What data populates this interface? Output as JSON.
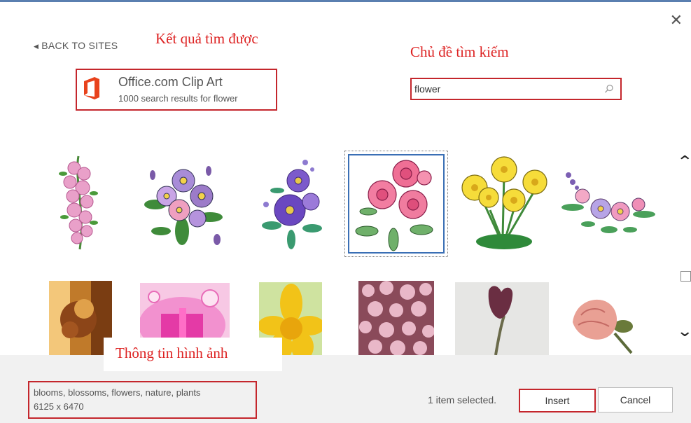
{
  "dialog": {
    "close_glyph": "✕"
  },
  "nav": {
    "back_label": "BACK TO SITES",
    "back_icon": "triangle-left-icon"
  },
  "annotations": {
    "results_found": "Kết quả tìm được",
    "search_topic": "Chủ đề tìm kiếm",
    "image_info": "Thông tin hình ảnh",
    "color": "#d22222"
  },
  "source": {
    "title": "Office.com Clip Art",
    "subtitle": "1000 search results for flower",
    "logo": "office-logo",
    "brand_color": "#e8421c"
  },
  "search": {
    "value": "flower",
    "icon": "search-icon"
  },
  "results": [
    {
      "name": "pink-blossom-branch",
      "kind": "clipart"
    },
    {
      "name": "purple-pansy-bouquet",
      "kind": "clipart"
    },
    {
      "name": "purple-aster-bouquet",
      "kind": "clipart"
    },
    {
      "name": "pink-rose-bouquet",
      "kind": "clipart",
      "selected": true
    },
    {
      "name": "yellow-buttercups",
      "kind": "clipart"
    },
    {
      "name": "pink-lavender-garland",
      "kind": "clipart"
    },
    {
      "name": "autumn-window-photo",
      "kind": "photo"
    },
    {
      "name": "pink-gift-card",
      "kind": "clipart"
    },
    {
      "name": "yellow-daffodil-photo",
      "kind": "photo"
    },
    {
      "name": "cherry-blossom-photo",
      "kind": "photo"
    },
    {
      "name": "purple-tulip-photo",
      "kind": "photo"
    },
    {
      "name": "pink-carnation-photo",
      "kind": "photo"
    }
  ],
  "scroll": {
    "up_glyph": "⌃",
    "down_glyph": "⌄"
  },
  "selection_info": {
    "keywords": "blooms, blossoms, flowers, nature, plants",
    "dimensions": "6125 x 6470"
  },
  "footer": {
    "status": "1 item selected.",
    "insert_label": "Insert",
    "cancel_label": "Cancel"
  },
  "colors": {
    "highlight_red": "#c4262c",
    "selection_blue": "#3a6fb5",
    "footer_bg": "#f1f1f1"
  }
}
